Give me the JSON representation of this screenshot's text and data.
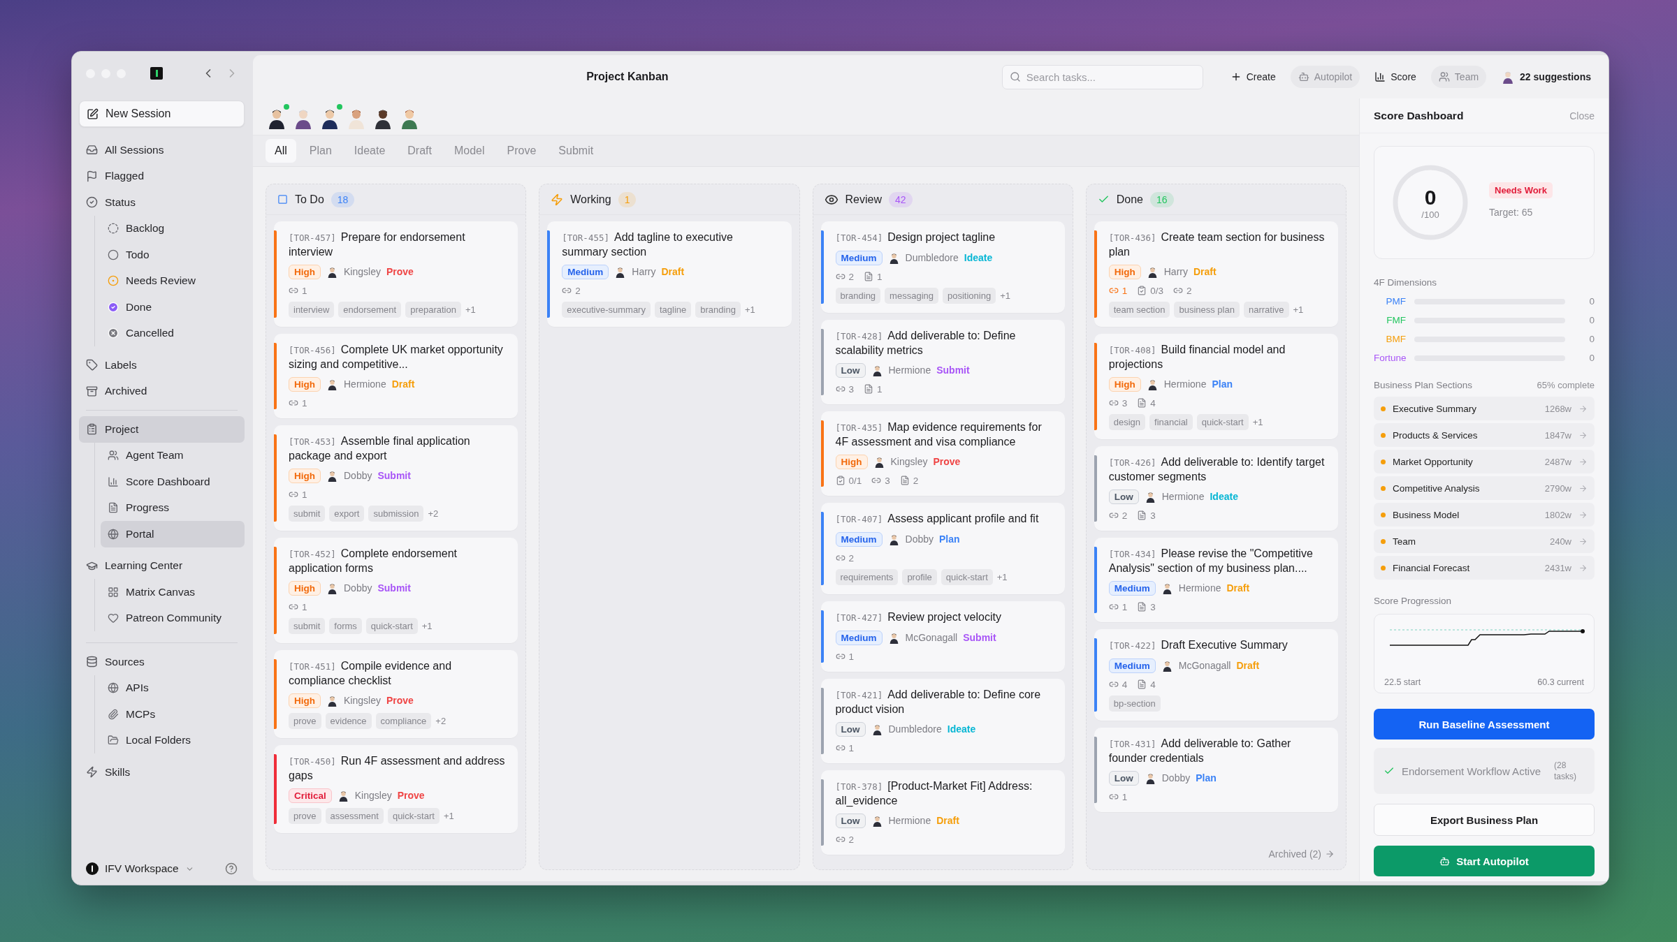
{
  "sidebar": {
    "new_session": "New Session",
    "groups": [
      {
        "items": [
          {
            "label": "All Sessions",
            "selected": false
          },
          {
            "label": "Flagged",
            "selected": false
          },
          {
            "label": "Status",
            "selected": false,
            "children": [
              {
                "label": "Backlog",
                "selected": false
              },
              {
                "label": "Todo",
                "selected": false
              },
              {
                "label": "Needs Review",
                "selected": false
              },
              {
                "label": "Done",
                "selected": false
              },
              {
                "label": "Cancelled",
                "selected": false
              }
            ]
          },
          {
            "label": "Labels",
            "selected": false
          },
          {
            "label": "Archived",
            "selected": false
          }
        ]
      },
      {
        "items": [
          {
            "label": "Project",
            "selected": true,
            "children": [
              {
                "label": "Agent Team",
                "selected": false
              },
              {
                "label": "Score Dashboard",
                "selected": false
              },
              {
                "label": "Progress",
                "selected": false
              },
              {
                "label": "Portal",
                "selected": true
              }
            ]
          },
          {
            "label": "Learning Center",
            "selected": false,
            "children": [
              {
                "label": "Matrix Canvas",
                "selected": false
              },
              {
                "label": "Patreon Community",
                "selected": false
              }
            ]
          }
        ]
      },
      {
        "items": [
          {
            "label": "Sources",
            "selected": false,
            "children": [
              {
                "label": "APIs",
                "selected": false
              },
              {
                "label": "MCPs",
                "selected": false
              },
              {
                "label": "Local Folders",
                "selected": false
              }
            ]
          },
          {
            "label": "Skills",
            "selected": false
          }
        ]
      }
    ],
    "workspace": "IFV Workspace"
  },
  "header": {
    "title": "Project Kanban",
    "search": {
      "placeholder": "Search tasks..."
    },
    "actions": [
      {
        "label": "Create",
        "muted": false
      },
      {
        "label": "Autopilot",
        "muted": true
      },
      {
        "label": "Score",
        "muted": false
      },
      {
        "label": "Team",
        "muted": true
      },
      {
        "label": "22 suggestions",
        "muted": false
      }
    ]
  },
  "team": [
    {
      "online": true
    },
    {
      "online": false
    },
    {
      "online": true
    },
    {
      "online": false
    },
    {
      "online": false
    },
    {
      "online": false
    }
  ],
  "tabs": [
    {
      "label": "All",
      "selected": true
    },
    {
      "label": "Plan",
      "selected": false
    },
    {
      "label": "Ideate",
      "selected": false
    },
    {
      "label": "Draft",
      "selected": false
    },
    {
      "label": "Model",
      "selected": false
    },
    {
      "label": "Prove",
      "selected": false
    },
    {
      "label": "Submit",
      "selected": false
    }
  ],
  "columns": [
    {
      "title": "To Do",
      "count": "18",
      "color": "#3b82f6",
      "cards": [
        {
          "id": "[TOR-457]",
          "title": "Prepare for endorsement interview",
          "priority": {
            "label": "High",
            "kind": "high"
          },
          "assignee": "Kingsley",
          "phase": {
            "label": "Prove",
            "color": "#ef4444"
          },
          "counts": [
            {
              "kind": "link",
              "value": "1"
            }
          ],
          "tags": [
            "interview",
            "endorsement",
            "preparation"
          ],
          "more_tags": "+1"
        },
        {
          "id": "[TOR-456]",
          "title": "Complete UK market opportunity sizing and competitive...",
          "priority": {
            "label": "High",
            "kind": "high"
          },
          "assignee": "Hermione",
          "phase": {
            "label": "Draft",
            "color": "#f59e0b"
          },
          "counts": [
            {
              "kind": "link",
              "value": "1"
            }
          ]
        },
        {
          "id": "[TOR-453]",
          "title": "Assemble final application package and export",
          "priority": {
            "label": "High",
            "kind": "high"
          },
          "assignee": "Dobby",
          "phase": {
            "label": "Submit",
            "color": "#a855f7"
          },
          "counts": [
            {
              "kind": "link",
              "value": "1"
            }
          ],
          "tags": [
            "submit",
            "export",
            "submission"
          ],
          "more_tags": "+2"
        },
        {
          "id": "[TOR-452]",
          "title": "Complete endorsement application forms",
          "priority": {
            "label": "High",
            "kind": "high"
          },
          "assignee": "Dobby",
          "phase": {
            "label": "Submit",
            "color": "#a855f7"
          },
          "counts": [
            {
              "kind": "link",
              "value": "1"
            }
          ],
          "tags": [
            "submit",
            "forms",
            "quick-start"
          ],
          "more_tags": "+1"
        },
        {
          "id": "[TOR-451]",
          "title": "Compile evidence and compliance checklist",
          "priority": {
            "label": "High",
            "kind": "high"
          },
          "assignee": "Kingsley",
          "phase": {
            "label": "Prove",
            "color": "#ef4444"
          },
          "tags": [
            "prove",
            "evidence",
            "compliance"
          ],
          "more_tags": "+2"
        },
        {
          "id": "[TOR-450]",
          "title": "Run 4F assessment and address gaps",
          "priority": {
            "label": "Critical",
            "kind": "critical"
          },
          "assignee": "Kingsley",
          "phase": {
            "label": "Prove",
            "color": "#ef4444"
          },
          "tags": [
            "prove",
            "assessment",
            "quick-start"
          ],
          "more_tags": "+1"
        }
      ]
    },
    {
      "title": "Working",
      "count": "1",
      "color": "#f59e0b",
      "cards": [
        {
          "id": "[TOR-455]",
          "title": "Add tagline to executive summary section",
          "priority": {
            "label": "Medium",
            "kind": "medium"
          },
          "assignee": "Harry",
          "phase": {
            "label": "Draft",
            "color": "#f59e0b"
          },
          "counts": [
            {
              "kind": "link",
              "value": "2"
            }
          ],
          "tags": [
            "executive-summary",
            "tagline",
            "branding"
          ],
          "more_tags": "+1"
        }
      ]
    },
    {
      "title": "Review",
      "count": "42",
      "color": "#a855f7",
      "cards": [
        {
          "id": "[TOR-454]",
          "title": "Design project tagline",
          "priority": {
            "label": "Medium",
            "kind": "medium"
          },
          "assignee": "Dumbledore",
          "phase": {
            "label": "Ideate",
            "color": "#06b6d4"
          },
          "counts": [
            {
              "kind": "link",
              "value": "2"
            },
            {
              "kind": "doc",
              "value": "1"
            }
          ],
          "tags": [
            "branding",
            "messaging",
            "positioning"
          ],
          "more_tags": "+1"
        },
        {
          "id": "[TOR-428]",
          "title": "Add deliverable to: Define scalability metrics",
          "priority": {
            "label": "Low",
            "kind": "low"
          },
          "assignee": "Hermione",
          "phase": {
            "label": "Submit",
            "color": "#a855f7"
          },
          "counts": [
            {
              "kind": "link",
              "value": "3"
            },
            {
              "kind": "doc",
              "value": "1"
            }
          ]
        },
        {
          "id": "[TOR-435]",
          "title": "Map evidence requirements for 4F assessment and visa compliance",
          "priority": {
            "label": "High",
            "kind": "high"
          },
          "assignee": "Kingsley",
          "phase": {
            "label": "Prove",
            "color": "#ef4444"
          },
          "counts": [
            {
              "kind": "checklist",
              "value": "0/1"
            },
            {
              "kind": "link",
              "value": "3"
            },
            {
              "kind": "doc",
              "value": "2"
            }
          ]
        },
        {
          "id": "[TOR-407]",
          "title": "Assess applicant profile and fit",
          "priority": {
            "label": "Medium",
            "kind": "medium"
          },
          "assignee": "Dobby",
          "phase": {
            "label": "Plan",
            "color": "#3b82f6"
          },
          "counts": [
            {
              "kind": "link",
              "value": "2"
            }
          ],
          "tags": [
            "requirements",
            "profile",
            "quick-start"
          ],
          "more_tags": "+1"
        },
        {
          "id": "[TOR-427]",
          "title": "Review project velocity",
          "priority": {
            "label": "Medium",
            "kind": "medium"
          },
          "assignee": "McGonagall",
          "phase": {
            "label": "Submit",
            "color": "#a855f7"
          },
          "counts": [
            {
              "kind": "link",
              "value": "1"
            }
          ]
        },
        {
          "id": "[TOR-421]",
          "title": "Add deliverable to: Define core product vision",
          "priority": {
            "label": "Low",
            "kind": "low"
          },
          "assignee": "Dumbledore",
          "phase": {
            "label": "Ideate",
            "color": "#06b6d4"
          },
          "counts": [
            {
              "kind": "link",
              "value": "1"
            }
          ]
        },
        {
          "id": "[TOR-378]",
          "title": "[Product-Market Fit] Address: all_evidence",
          "priority": {
            "label": "Low",
            "kind": "low"
          },
          "assignee": "Hermione",
          "phase": {
            "label": "Draft",
            "color": "#f59e0b"
          },
          "counts": [
            {
              "kind": "link",
              "value": "2"
            }
          ]
        }
      ]
    },
    {
      "title": "Done",
      "count": "16",
      "color": "#22c55e",
      "footer": "Archived (2)",
      "cards": [
        {
          "id": "[TOR-436]",
          "title": "Create team section for business plan",
          "priority": {
            "label": "High",
            "kind": "high"
          },
          "assignee": "Harry",
          "phase": {
            "label": "Draft",
            "color": "#f59e0b"
          },
          "counts": [
            {
              "kind": "blocker",
              "value": "1"
            },
            {
              "kind": "checklist",
              "value": "0/3"
            },
            {
              "kind": "link",
              "value": "2"
            }
          ],
          "tags": [
            "team section",
            "business plan",
            "narrative"
          ],
          "more_tags": "+1"
        },
        {
          "id": "[TOR-408]",
          "title": "Build financial model and projections",
          "priority": {
            "label": "High",
            "kind": "high"
          },
          "assignee": "Hermione",
          "phase": {
            "label": "Plan",
            "color": "#3b82f6"
          },
          "counts": [
            {
              "kind": "link",
              "value": "3"
            },
            {
              "kind": "doc",
              "value": "4"
            }
          ],
          "tags": [
            "design",
            "financial",
            "quick-start"
          ],
          "more_tags": "+1"
        },
        {
          "id": "[TOR-426]",
          "title": "Add deliverable to: Identify target customer segments",
          "priority": {
            "label": "Low",
            "kind": "low"
          },
          "assignee": "Hermione",
          "phase": {
            "label": "Ideate",
            "color": "#06b6d4"
          },
          "counts": [
            {
              "kind": "link",
              "value": "2"
            },
            {
              "kind": "doc",
              "value": "3"
            }
          ]
        },
        {
          "id": "[TOR-434]",
          "title": "Please revise the \"Competitive Analysis\" section of my business plan....",
          "priority": {
            "label": "Medium",
            "kind": "medium"
          },
          "assignee": "Hermione",
          "phase": {
            "label": "Draft",
            "color": "#f59e0b"
          },
          "counts": [
            {
              "kind": "link",
              "value": "1"
            },
            {
              "kind": "doc",
              "value": "3"
            }
          ]
        },
        {
          "id": "[TOR-422]",
          "title": "Draft Executive Summary",
          "priority": {
            "label": "Medium",
            "kind": "medium"
          },
          "assignee": "McGonagall",
          "phase": {
            "label": "Draft",
            "color": "#f59e0b"
          },
          "counts": [
            {
              "kind": "link",
              "value": "4"
            },
            {
              "kind": "doc",
              "value": "4"
            }
          ],
          "tags": [
            "bp-section"
          ]
        },
        {
          "id": "[TOR-431]",
          "title": "Add deliverable to: Gather founder credentials",
          "priority": {
            "label": "Low",
            "kind": "low"
          },
          "assignee": "Dobby",
          "phase": {
            "label": "Plan",
            "color": "#3b82f6"
          },
          "counts": [
            {
              "kind": "link",
              "value": "1"
            }
          ]
        }
      ]
    }
  ],
  "score_panel": {
    "title": "Score Dashboard",
    "close": "Close",
    "score": {
      "value": "0",
      "out_of": "/100",
      "status": "Needs Work",
      "target": "Target: 65"
    },
    "dimensions": {
      "heading": "4F Dimensions",
      "items": [
        {
          "label": "PMF",
          "color": "#3b82f6",
          "level": 0,
          "value": "0"
        },
        {
          "label": "FMF",
          "color": "#22c55e",
          "level": 0,
          "value": "0"
        },
        {
          "label": "BMF",
          "color": "#f59e0b",
          "level": 0,
          "value": "0"
        },
        {
          "label": "Fortune",
          "color": "#a855f7",
          "level": 0,
          "value": "0"
        }
      ]
    },
    "sections": {
      "heading": "Business Plan Sections",
      "progress": "65% complete",
      "items": [
        {
          "label": "Executive Summary",
          "words": "1268w",
          "color": "#f59e0b"
        },
        {
          "label": "Products & Services",
          "words": "1847w",
          "color": "#f59e0b"
        },
        {
          "label": "Market Opportunity",
          "words": "2487w",
          "color": "#f59e0b"
        },
        {
          "label": "Competitive Analysis",
          "words": "2790w",
          "color": "#f59e0b"
        },
        {
          "label": "Business Model",
          "words": "1802w",
          "color": "#f59e0b"
        },
        {
          "label": "Team",
          "words": "240w",
          "color": "#f59e0b"
        },
        {
          "label": "Financial Forecast",
          "words": "2431w",
          "color": "#f59e0b"
        }
      ]
    },
    "progression": {
      "heading": "Score Progression",
      "start": "22.5 start",
      "current": "60.3 current"
    },
    "run_button": "Run Baseline Assessment",
    "workflow": {
      "label": "Endorsement Workflow Active",
      "tasks": "(28 tasks)",
      "active": true
    },
    "export_button": "Export Business Plan",
    "autopilot_button": "Start Autopilot"
  }
}
